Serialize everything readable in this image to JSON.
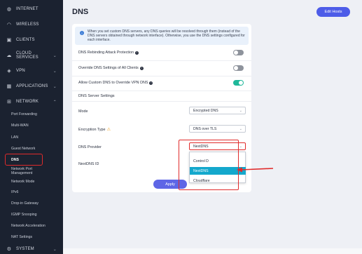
{
  "sidebar": {
    "items": [
      {
        "label": "INTERNET",
        "icon": "globe-icon"
      },
      {
        "label": "WIRELESS",
        "icon": "wifi-icon"
      },
      {
        "label": "CLIENTS",
        "icon": "clients-icon"
      },
      {
        "label": "CLOUD SERVICES",
        "icon": "cloud-icon"
      },
      {
        "label": "VPN",
        "icon": "shield-icon"
      },
      {
        "label": "APPLICATIONS",
        "icon": "apps-icon"
      },
      {
        "label": "NETWORK",
        "icon": "network-icon"
      }
    ],
    "network_subitems": [
      "Port Forwarding",
      "Multi-WAN",
      "LAN",
      "Guest Network",
      "DNS",
      "Network Port\nManagement",
      "Network Mode",
      "IPv6",
      "Drop-in Gateway",
      "IGMP Snooping",
      "Network Acceleration",
      "NAT Settings"
    ],
    "bottom_item": {
      "label": "SYSTEM",
      "icon": "gear-icon"
    },
    "active_subitem": "DNS"
  },
  "header": {
    "title": "DNS",
    "edit_hosts_label": "Edit Hosts"
  },
  "info": {
    "text": "When you set custom DNS servers, any DNS queries will be resolved through them (instead of the DNS servers obtained through network interface). Otherwise, you use the DNS settings configured for each interface."
  },
  "settings": {
    "rebinding_label": "DNS Rebinding Attack Protection",
    "rebinding_on": false,
    "override_label": "Override DNS Settings of All Clients",
    "override_on": false,
    "allow_custom_label": "Allow Custom DNS to Override VPN DNS",
    "allow_custom_on": true
  },
  "dns_server": {
    "section_title": "DNS Server Settings",
    "mode_label": "Mode",
    "mode_value": "Encrypted DNS",
    "encryption_label": "Encryption Type",
    "encryption_value": "DNS over TLS",
    "provider_label": "DNS Provider",
    "provider_value": "NextDNS",
    "nextdns_id_label": "NextDNS ID",
    "provider_options": [
      "Control D",
      "NextDNS",
      "Cloudflare"
    ],
    "provider_selected": "NextDNS"
  },
  "apply_label": "Apply",
  "colors": {
    "sidebar_bg": "#1b2230",
    "accent": "#4d5ce8",
    "toggle_on": "#1fb89a",
    "highlight": "#e02b2b",
    "selected_option": "#14a8cc"
  }
}
